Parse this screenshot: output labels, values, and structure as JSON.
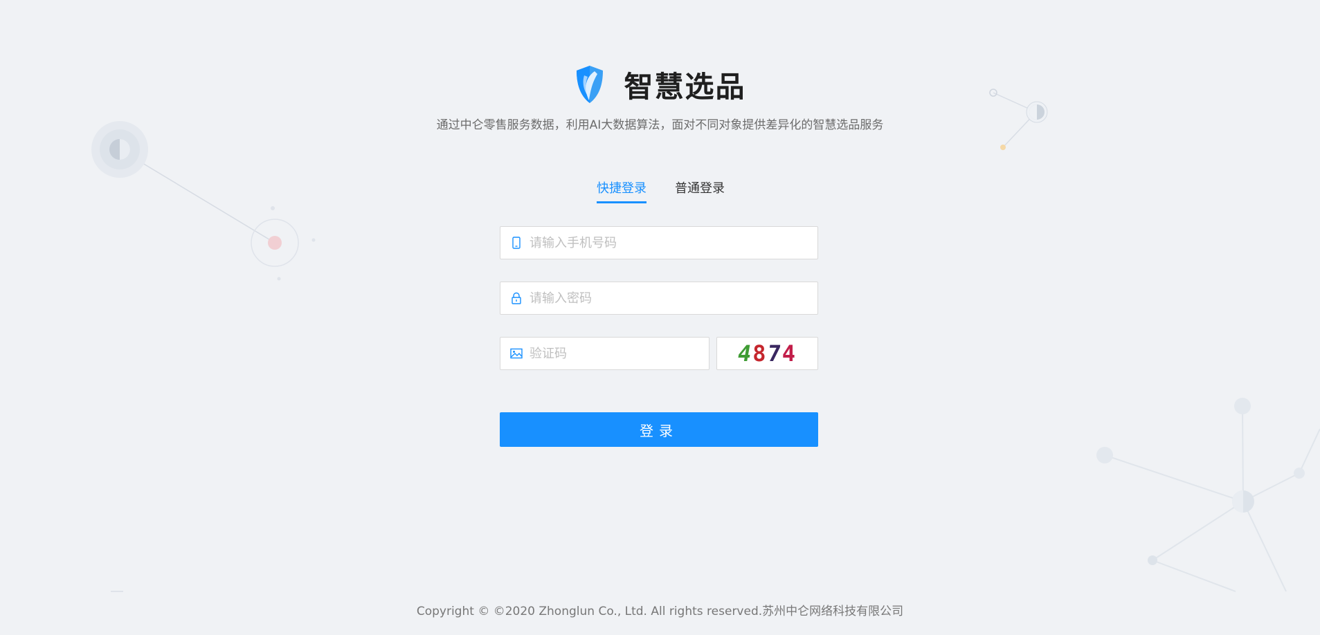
{
  "brand": {
    "title": "智慧选品",
    "logo_icon": "shield-leaf-icon",
    "logo_color": "#1890ff"
  },
  "subtitle": "通过中仑零售服务数据，利用AI大数据算法，面对不同对象提供差异化的智慧选品服务",
  "tabs": [
    {
      "label": "快捷登录",
      "active": true
    },
    {
      "label": "普通登录",
      "active": false
    }
  ],
  "form": {
    "phone": {
      "placeholder": "请输入手机号码",
      "value": "",
      "icon": "mobile-phone-icon"
    },
    "password": {
      "placeholder": "请输入密码",
      "value": "",
      "icon": "lock-icon"
    },
    "code": {
      "placeholder": "验证码",
      "value": "",
      "icon": "image-icon"
    },
    "captcha": {
      "digits": [
        "4",
        "8",
        "7",
        "4"
      ]
    },
    "submit_label": "登录"
  },
  "footer": "Copyright © ©2020 Zhonglun Co., Ltd. All rights reserved.苏州中仑网络科技有限公司",
  "colors": {
    "accent": "#1890ff",
    "background": "#f0f2f5"
  }
}
